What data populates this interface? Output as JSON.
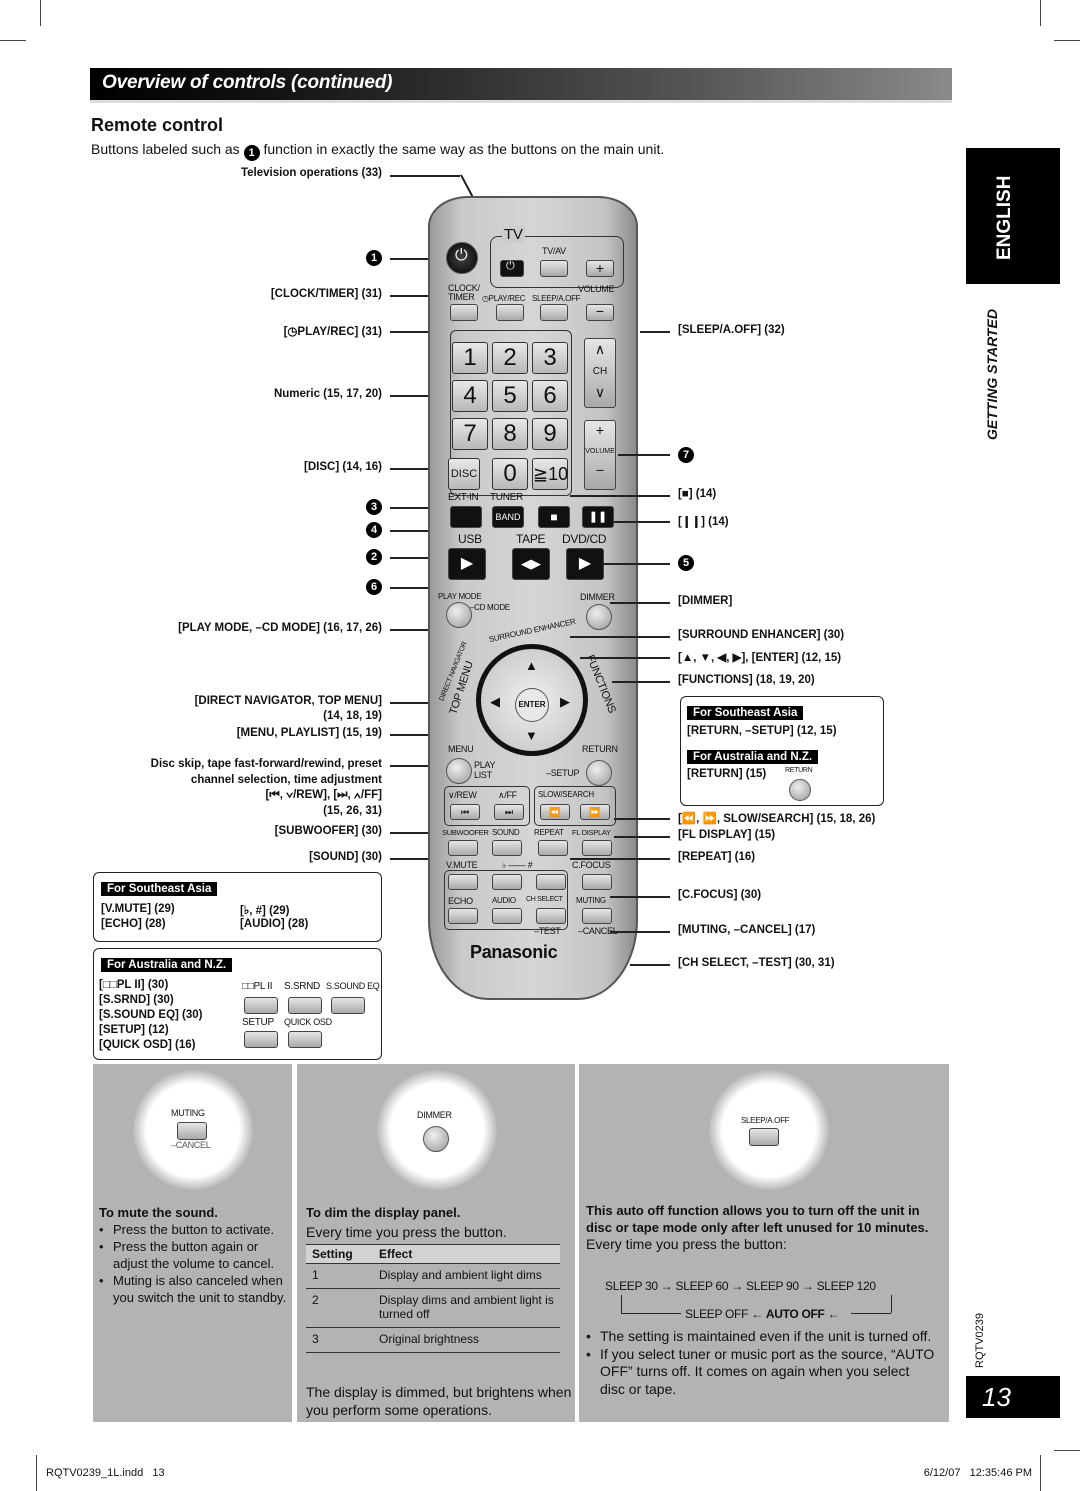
{
  "header": {
    "title": "Overview of controls (continued)"
  },
  "section": {
    "title": "Remote control",
    "intro_before": "Buttons labeled such as",
    "intro_badge": "1",
    "intro_after": "function in exactly the same way as the buttons on the main unit."
  },
  "side_tab": {
    "language": "ENGLISH",
    "chapter": "GETTING STARTED",
    "doc_code": "RQTV0239",
    "page_number": "13"
  },
  "left_labels": {
    "tv_ops": "Television operations (33)",
    "badge1": "1",
    "clock_timer": "[CLOCK/TIMER] (31)",
    "play_rec": "[◷PLAY/REC] (31)",
    "numeric": "Numeric (15, 17, 20)",
    "disc": "[DISC] (14, 16)",
    "badge3": "3",
    "badge4": "4",
    "badge2": "2",
    "badge6": "6",
    "play_mode": "[PLAY MODE, –CD MODE] (16, 17, 26)",
    "direct_nav": "[DIRECT NAVIGATOR, TOP MENU]",
    "direct_nav_pages": "(14, 18, 19)",
    "menu_playlist": "[MENU, PLAYLIST] (15, 19)",
    "disc_skip_1": "Disc skip, tape fast-forward/rewind, preset",
    "disc_skip_2": "channel selection, time adjustment",
    "disc_skip_3": "[⏮, ∨/REW], [⏭, ∧/FF]",
    "disc_skip_4": "(15, 26, 31)",
    "subwoofer": "[SUBWOOFER] (30)",
    "sound": "[SOUND] (30)"
  },
  "sea_box": {
    "tag": "For Southeast Asia",
    "items": [
      "[V.MUTE] (29)",
      "[♭, #] (29)",
      "[ECHO] (28)",
      "[AUDIO] (28)"
    ]
  },
  "anz_box": {
    "tag": "For Australia and N.Z.",
    "items": [
      "[□□PL II] (30)",
      "[S.SRND] (30)",
      "[S.SOUND EQ] (30)",
      "[SETUP] (12)",
      "[QUICK OSD] (16)"
    ],
    "button_labels": [
      "□□PL II",
      "S.SRND",
      "S.SOUND EQ",
      "SETUP",
      "QUICK OSD"
    ]
  },
  "right_labels": {
    "sleep": "[SLEEP/A.OFF] (32)",
    "badge7": "7",
    "stop": "[■] (14)",
    "pause": "[❙❙] (14)",
    "badge5": "5",
    "dimmer": "[DIMMER]",
    "surround": "[SURROUND ENHANCER] (30)",
    "arrows": "[▲, ▼, ◀, ▶], [ENTER] (12, 15)",
    "functions": "[FUNCTIONS] (18, 19, 20)",
    "sea_tag": "For Southeast Asia",
    "return_setup": "[RETURN, –SETUP] (12, 15)",
    "anz_tag": "For Australia and N.Z.",
    "return": "[RETURN] (15)",
    "return_btn": "RETURN",
    "slow_search": "[⏪, ⏩, SLOW/SEARCH] (15, 18, 26)",
    "fl_display": "[FL DISPLAY] (15)",
    "repeat": "[REPEAT] (16)",
    "c_focus": "[C.FOCUS] (30)",
    "muting": "[MUTING, –CANCEL] (17)",
    "ch_select": "[CH SELECT, –TEST] (30, 31)"
  },
  "remote": {
    "tv": "TV",
    "tv_av": "TV/AV",
    "clock_timer": "CLOCK/\nTIMER",
    "play_rec": "◷PLAY/REC",
    "sleep": "SLEEP/A.OFF",
    "volume": "VOLUME",
    "ch": "CH",
    "digits": [
      "1",
      "2",
      "3",
      "4",
      "5",
      "6",
      "7",
      "8",
      "9"
    ],
    "disc": "DISC",
    "zero": "0",
    "ten": "≧10",
    "ext_in": "EXT-IN",
    "tuner": "TUNER",
    "band": "BAND",
    "usb": "USB",
    "tape": "TAPE",
    "dvd_cd": "DVD/CD",
    "play_mode": "PLAY MODE",
    "cd_mode": "–CD MODE",
    "dimmer": "DIMMER",
    "surround": "SURROUND ENHANCER",
    "direct_nav": "DIRECT NAVIGATOR",
    "top_menu": "TOP MENU",
    "functions": "FUNCTIONS",
    "enter": "ENTER",
    "menu": "MENU",
    "play_list": "PLAY LIST",
    "return": "RETURN",
    "setup": "–SETUP",
    "rew": "∨/REW",
    "ff": "∧/FF",
    "slow_search": "SLOW/SEARCH",
    "subwoofer": "SUBWOOFER",
    "sound": "SOUND",
    "repeat": "REPEAT",
    "fl_display": "FL DISPLAY",
    "v_mute": "V.MUTE",
    "flat_sharp": "♭ —— #",
    "c_focus": "C.FOCUS",
    "echo": "ECHO",
    "audio": "AUDIO",
    "ch_select": "CH SELECT",
    "muting": "MUTING",
    "test": "–TEST",
    "cancel": "–CANCEL",
    "brand": "Panasonic"
  },
  "panels": {
    "mute": {
      "btn_top": "MUTING",
      "btn_bottom": "–CANCEL",
      "title": "To mute the sound.",
      "bullets": [
        "Press the button to activate.",
        "Press the button again or adjust the volume to cancel.",
        "Muting is also canceled when you switch the unit to standby."
      ]
    },
    "dim": {
      "btn_label": "DIMMER",
      "title": "To dim the display panel.",
      "sub": "Every time you press the button.",
      "table_headers": [
        "Setting",
        "Effect"
      ],
      "rows": [
        {
          "setting": "1",
          "effect": "Display and ambient light dims"
        },
        {
          "setting": "2",
          "effect": "Display dims and ambient light is turned off"
        },
        {
          "setting": "3",
          "effect": "Original brightness"
        }
      ],
      "note": "The display is dimmed, but brightens when you perform some operations."
    },
    "sleep": {
      "btn_label": "SLEEP/A.OFF",
      "title": "This auto off function allows you to turn off the unit in disc or tape mode only after left unused for 10 minutes.",
      "sub": "Every time you press the button:",
      "cycle_top": "SLEEP 30 → SLEEP 60 → SLEEP 90 → SLEEP 120",
      "cycle_bottom_a": "SLEEP OFF ← ",
      "cycle_bottom_b": "AUTO OFF",
      "cycle_bottom_c": " ←",
      "bullets": [
        "The setting is maintained even if the unit is turned off.",
        "If you select tuner or music port as the source, “AUTO OFF” turns off. It comes on again when you select disc or tape."
      ]
    }
  },
  "footer": {
    "file": "RQTV0239_1L.indd   13",
    "timestamp": "6/12/07   12:35:46 PM"
  }
}
